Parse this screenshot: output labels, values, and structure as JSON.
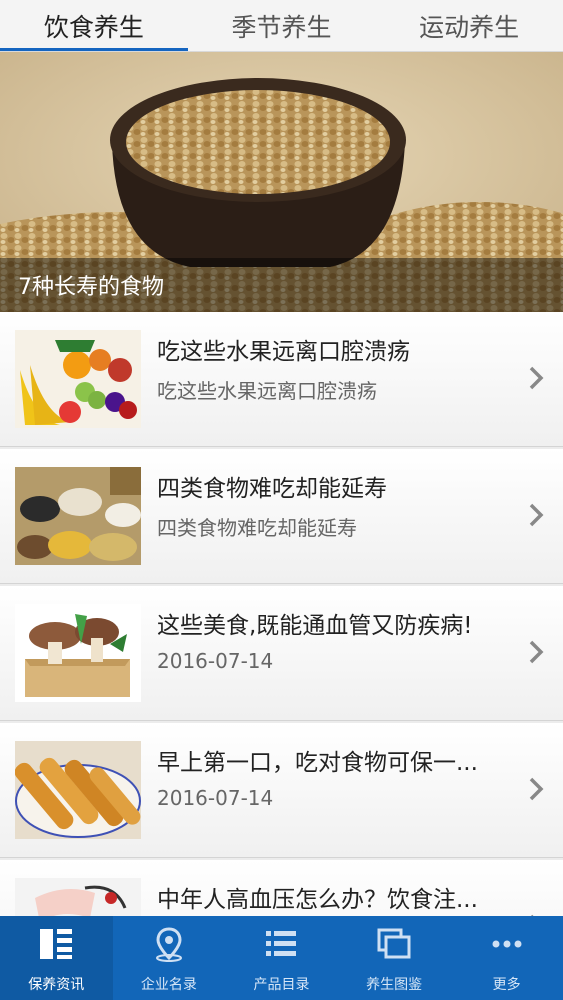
{
  "tabs": [
    "饮食养生",
    "季节养生",
    "运动养生"
  ],
  "hero": {
    "caption": "7种长寿的食物"
  },
  "items": [
    {
      "title": "吃这些水果远离口腔溃疡",
      "sub": "吃这些水果远离口腔溃疡"
    },
    {
      "title": "四类食物难吃却能延寿",
      "sub": "四类食物难吃却能延寿"
    },
    {
      "title": "这些美食,既能通血管又防疾病!",
      "sub": "2016-07-14"
    },
    {
      "title": "早上第一口，吃对食物可保一...",
      "sub": "2016-07-14"
    },
    {
      "title": "中年人高血压怎么办？饮食注...",
      "sub": ""
    }
  ],
  "nav": [
    "保养资讯",
    "企业名录",
    "产品目录",
    "养生图鉴",
    "更多"
  ],
  "colors": {
    "nav_bg": "#1266b8",
    "tab_indicator": "#1565c0"
  }
}
